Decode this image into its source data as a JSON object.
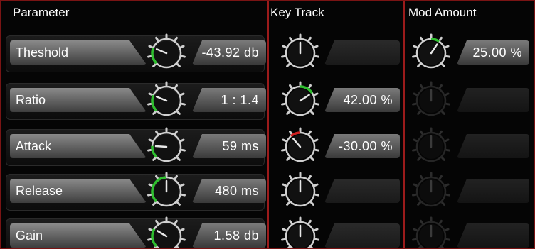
{
  "headers": {
    "parameter": "Parameter",
    "key_track": "Key Track",
    "mod_amount": "Mod Amount"
  },
  "colors": {
    "border": "#9b1b1b",
    "positive_arc": "#2fbf2f",
    "negative_arc": "#d02020"
  },
  "rows": [
    {
      "label": "Theshold",
      "value": "-43.92 db",
      "knob_level": 0.25,
      "key_track": {
        "value": "",
        "amount": 0.0
      },
      "mod_amount": {
        "value": "25.00 %",
        "amount": 0.25
      }
    },
    {
      "label": "Ratio",
      "value": "1 : 1.4",
      "knob_level": 0.25,
      "key_track": {
        "value": "42.00 %",
        "amount": 0.42
      },
      "mod_amount": {
        "value": "",
        "amount": 0.0
      }
    },
    {
      "label": "Attack",
      "value": "59 ms",
      "knob_level": 0.18,
      "key_track": {
        "value": "-30.00 %",
        "amount": -0.3
      },
      "mod_amount": {
        "value": "",
        "amount": 0.0
      }
    },
    {
      "label": "Release",
      "value": "480 ms",
      "knob_level": 0.5,
      "key_track": {
        "value": "",
        "amount": 0.0
      },
      "mod_amount": {
        "value": "",
        "amount": 0.0
      }
    },
    {
      "label": "Gain",
      "value": "1.58 db",
      "knob_level": 0.28,
      "key_track": {
        "value": "",
        "amount": 0.0
      },
      "mod_amount": {
        "value": "",
        "amount": 0.0
      }
    }
  ]
}
